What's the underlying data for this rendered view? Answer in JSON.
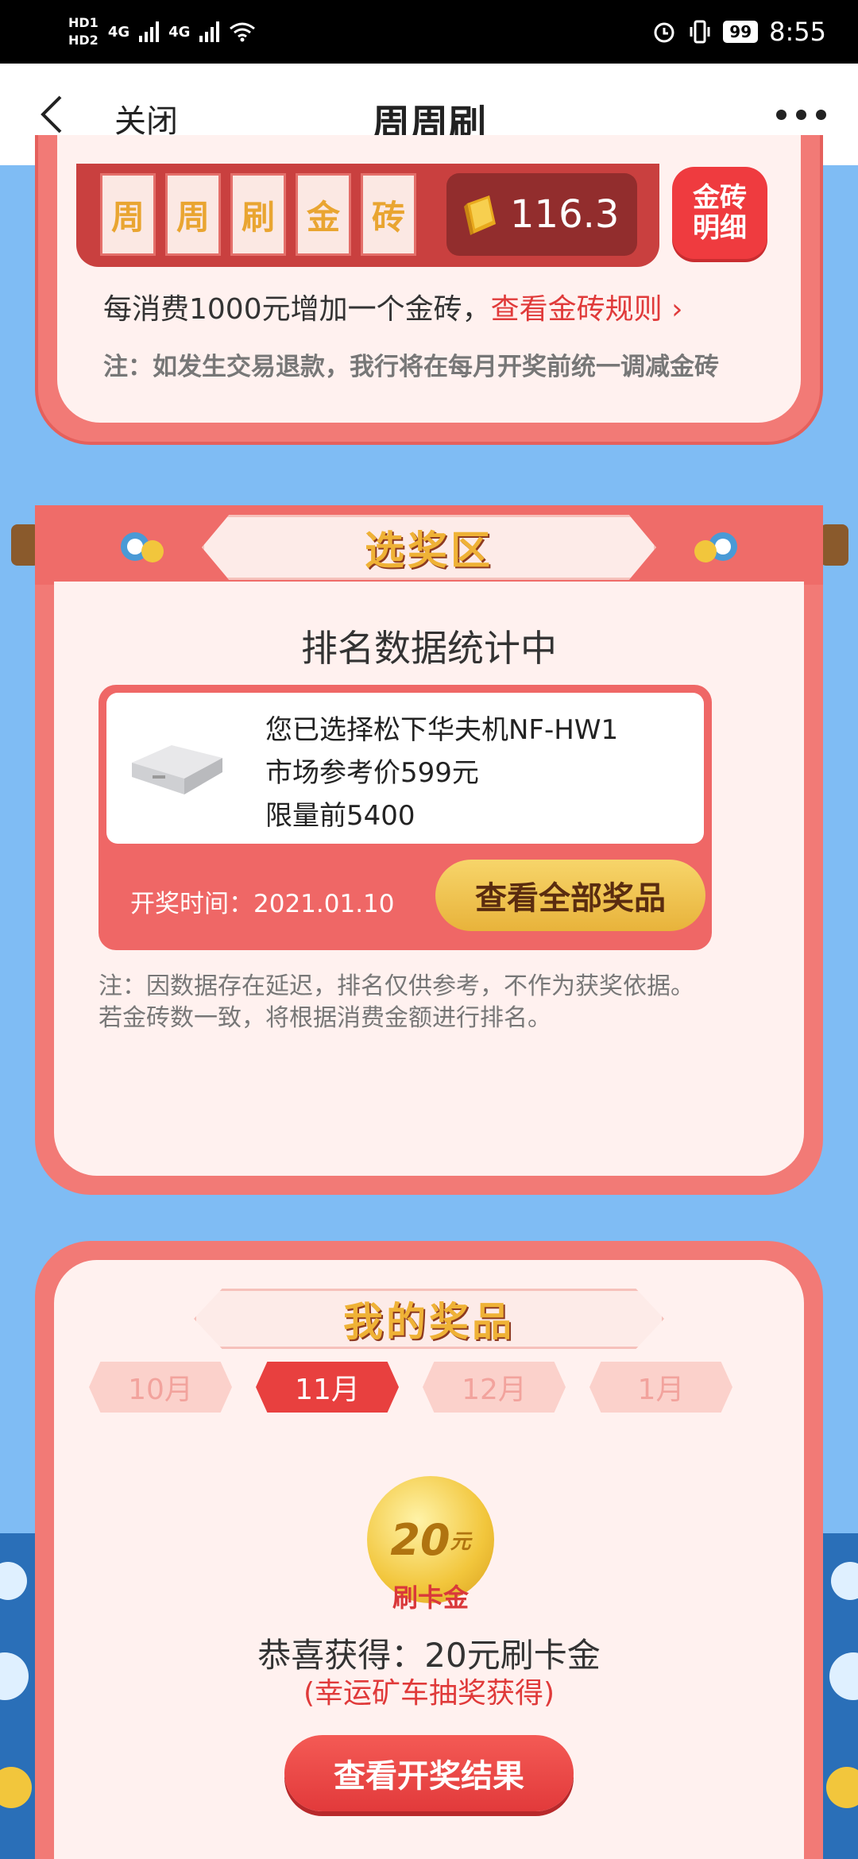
{
  "status": {
    "hd1": "HD1",
    "hd2": "HD2",
    "net1": "4G",
    "net2": "4G",
    "battery": "99",
    "time": "8:55"
  },
  "nav": {
    "close": "关闭",
    "title": "周周刷"
  },
  "bricks": {
    "tiles": [
      "周",
      "周",
      "刷",
      "金",
      "砖"
    ],
    "count": "116.3",
    "detail_line1": "金砖",
    "detail_line2": "明细",
    "rule_text": "每消费1000元增加一个金砖，",
    "rule_link": "查看金砖规则",
    "note": "注：如发生交易退款，我行将在每月开奖前统一调减金砖"
  },
  "select_zone": {
    "banner": "选奖区",
    "stat_title": "排名数据统计中",
    "prize_name": "您已选择松下华夫机NF-HW1",
    "prize_price": "市场参考价599元",
    "prize_limit": "限量前5400",
    "draw_time": "开奖时间：2021.01.10",
    "all_prizes_button": "查看全部奖品",
    "note_line1": "注：因数据存在延迟，排名仅供参考，不作为获奖依据。",
    "note_line2": "若金砖数一致，将根据消费金额进行排名。"
  },
  "my_prizes": {
    "banner": "我的奖品",
    "months": [
      "10月",
      "11月",
      "12月",
      "1月"
    ],
    "active_month": "11月",
    "coin_value": "20",
    "coin_unit": "元",
    "coin_label": "刷卡金",
    "won_text": "恭喜获得：20元刷卡金",
    "won_sub": "(幸运矿车抽奖获得)",
    "result_button": "查看开奖结果"
  },
  "colors": {
    "page_bg": "#7fbcf4",
    "panel_red": "#f27a76",
    "panel_inner": "#fff1ef",
    "accent_red": "#e03a3a",
    "gold": "#f2c63c"
  }
}
